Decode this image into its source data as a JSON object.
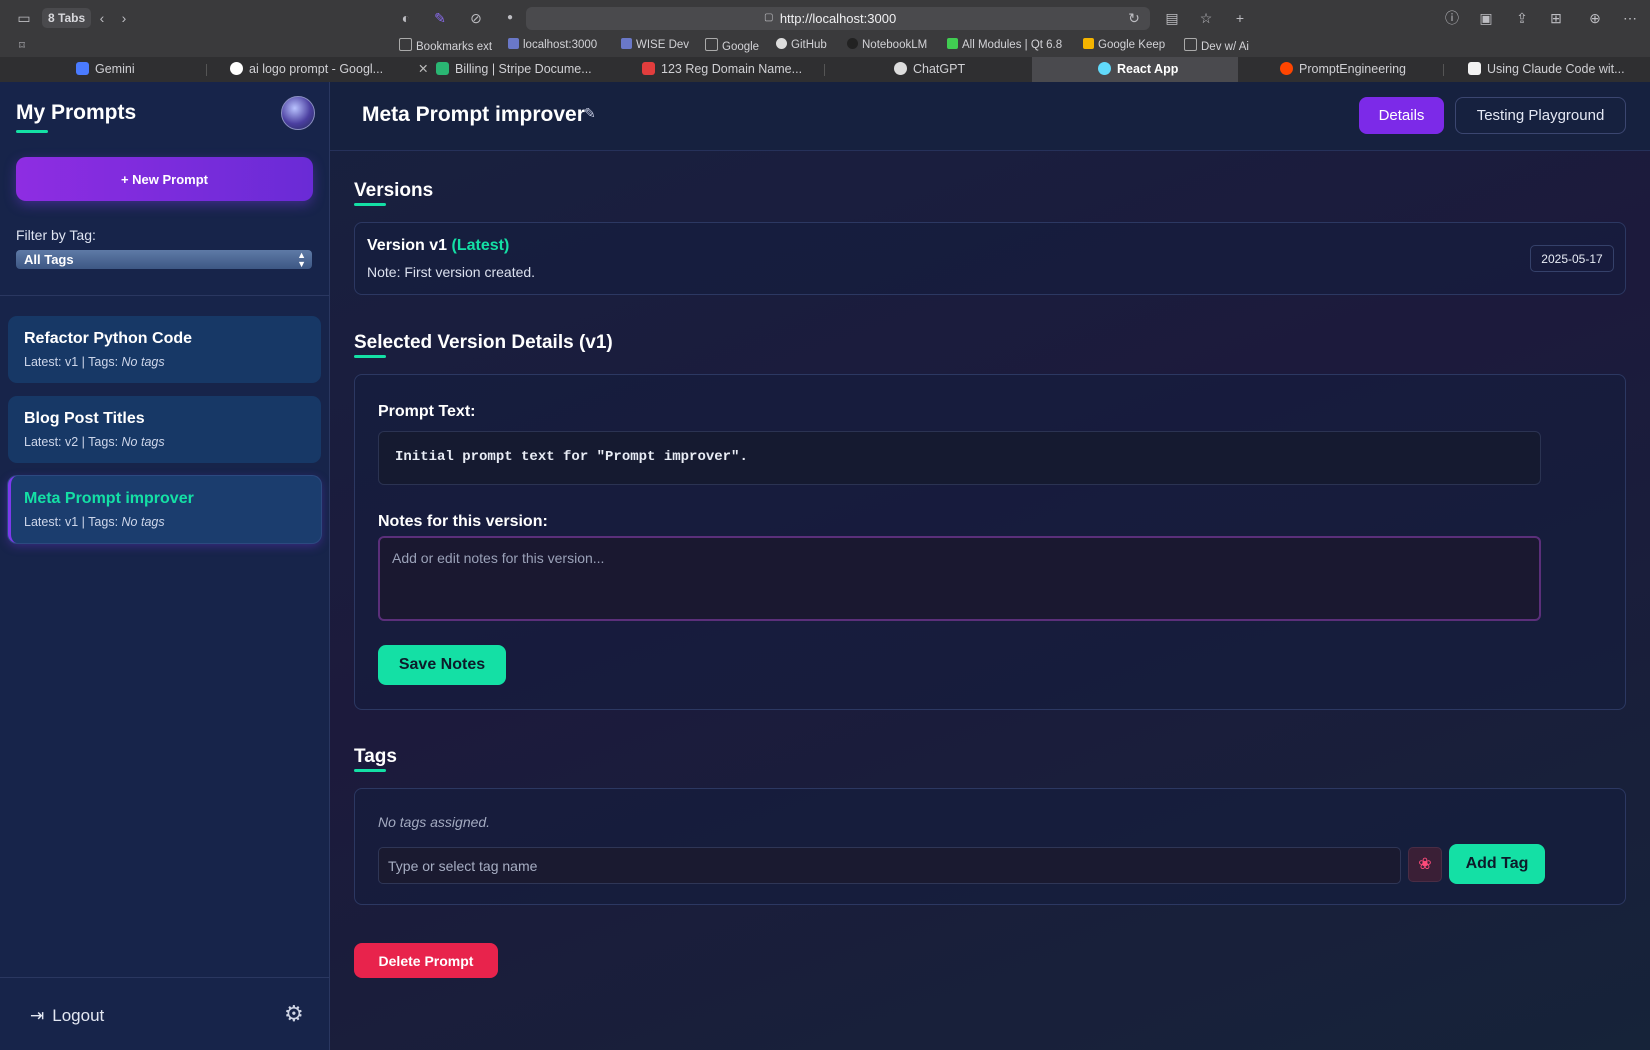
{
  "browser": {
    "tabs_count": "8 Tabs",
    "url": "http://localhost:3000",
    "bookmarks": [
      "Bookmarks ext",
      "localhost:3000",
      "WISE Dev",
      "Google",
      "GitHub",
      "NotebookLM",
      "All Modules | Qt 6.8",
      "Google Keep",
      "Dev w/ Ai"
    ],
    "tabs": [
      "Gemini",
      "ai logo prompt - Googl...",
      "Billing | Stripe Docume...",
      "123 Reg Domain Name...",
      "ChatGPT",
      "React App",
      "PromptEngineering",
      "Using Claude Code wit..."
    ],
    "active_tab": "React App"
  },
  "sidebar": {
    "title": "My Prompts",
    "new_prompt_label": "+ New Prompt",
    "filter_label": "Filter by Tag:",
    "filter_value": "All Tags",
    "prompts": [
      {
        "title": "Refactor Python Code",
        "meta_prefix": "Latest: v1 | Tags: ",
        "tags": "No tags"
      },
      {
        "title": "Blog Post Titles",
        "meta_prefix": "Latest: v2 | Tags: ",
        "tags": "No tags"
      },
      {
        "title": "Meta Prompt improver",
        "meta_prefix": "Latest: v1 | Tags: ",
        "tags": "No tags"
      }
    ],
    "logout_label": "Logout"
  },
  "header": {
    "title": "Meta Prompt improver",
    "details_label": "Details",
    "playground_label": "Testing Playground"
  },
  "versions": {
    "section_title": "Versions",
    "items": [
      {
        "label": "Version v1 ",
        "latest": "(Latest)",
        "note": "Note: First version created.",
        "date": "2025-05-17"
      }
    ]
  },
  "details": {
    "section_title": "Selected Version Details (v1)",
    "prompt_label": "Prompt Text:",
    "prompt_text": "Initial prompt text for \"Prompt improver\".",
    "notes_label": "Notes for this version:",
    "notes_placeholder": "Add or edit notes for this version...",
    "save_label": "Save Notes"
  },
  "tags": {
    "section_title": "Tags",
    "empty_text": "No tags assigned.",
    "input_placeholder": "Type or select tag name",
    "add_label": "Add Tag"
  },
  "delete_label": "Delete Prompt",
  "colors": {
    "accent": "#14e0a5",
    "primary": "#7c2ae8",
    "danger": "#e8234c"
  }
}
